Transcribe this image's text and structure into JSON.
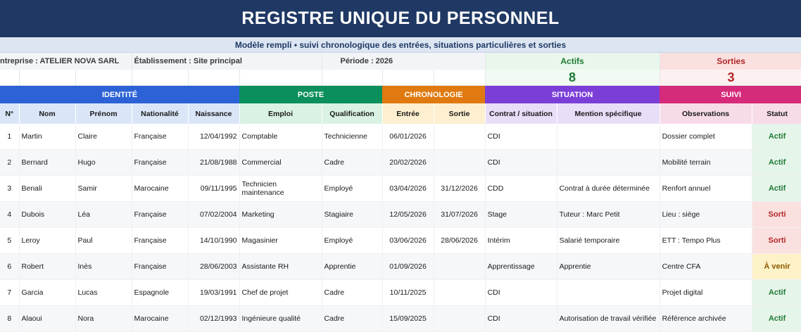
{
  "title": "REGISTRE UNIQUE DU PERSONNEL",
  "subtitle": "Modèle rempli • suivi chronologique des entrées, situations particulières et sorties",
  "info": {
    "entreprise": "ntreprise : ATELIER NOVA SARL",
    "etablissement": "Établissement : Site principal",
    "periode": "Période : 2026"
  },
  "summary": {
    "actifs_label": "Actifs",
    "actifs_value": "8",
    "sorties_label": "Sorties",
    "sorties_value": "3"
  },
  "groups": {
    "identite": "IDENTITÉ",
    "poste": "POSTE",
    "chronologie": "CHRONOLOGIE",
    "situation": "SITUATION",
    "suivi": "SUIVI"
  },
  "columns": {
    "num": "N°",
    "nom": "Nom",
    "prenom": "Prénom",
    "nationalite": "Nationalité",
    "naissance": "Naissance",
    "emploi": "Emploi",
    "qualification": "Qualification",
    "entree": "Entrée",
    "sortie": "Sortie",
    "contrat": "Contrat / situation",
    "mention": "Mention spécifique",
    "observations": "Observations",
    "statut": "Statut"
  },
  "status_colors": {
    "Actif": "#1e7b34",
    "Sorti": "#b32626",
    "À venir": "#8a5a00"
  },
  "rows": [
    {
      "n": "1",
      "nom": "Martin",
      "prenom": "Claire",
      "nat": "Française",
      "naiss": "12/04/1992",
      "emploi": "Comptable",
      "qual": "Technicienne",
      "entree": "06/01/2026",
      "sortie": "",
      "contrat": "CDI",
      "mention": "",
      "obs": "Dossier complet",
      "statut": "Actif",
      "status_type": "actif"
    },
    {
      "n": "2",
      "nom": "Bernard",
      "prenom": "Hugo",
      "nat": "Française",
      "naiss": "21/08/1988",
      "emploi": "Commercial",
      "qual": "Cadre",
      "entree": "20/02/2026",
      "sortie": "",
      "contrat": "CDI",
      "mention": "",
      "obs": "Mobilité terrain",
      "statut": "Actif",
      "status_type": "actif"
    },
    {
      "n": "3",
      "nom": "Benali",
      "prenom": "Samir",
      "nat": "Marocaine",
      "naiss": "09/11/1995",
      "emploi": "Technicien maintenance",
      "qual": "Employé",
      "entree": "03/04/2026",
      "sortie": "31/12/2026",
      "contrat": "CDD",
      "mention": "Contrat à durée déterminée",
      "obs": "Renfort annuel",
      "statut": "Actif",
      "status_type": "actif"
    },
    {
      "n": "4",
      "nom": "Dubois",
      "prenom": "Léa",
      "nat": "Française",
      "naiss": "07/02/2004",
      "emploi": "Marketing",
      "qual": "Stagiaire",
      "entree": "12/05/2026",
      "sortie": "31/07/2026",
      "contrat": "Stage",
      "mention": "Tuteur : Marc Petit",
      "obs": "Lieu : siège",
      "statut": "Sorti",
      "status_type": "sorti"
    },
    {
      "n": "5",
      "nom": "Leroy",
      "prenom": "Paul",
      "nat": "Française",
      "naiss": "14/10/1990",
      "emploi": "Magasinier",
      "qual": "Employé",
      "entree": "03/06/2026",
      "sortie": "28/06/2026",
      "contrat": "Intérim",
      "mention": "Salarié temporaire",
      "obs": "ETT : Tempo Plus",
      "statut": "Sorti",
      "status_type": "sorti"
    },
    {
      "n": "6",
      "nom": "Robert",
      "prenom": "Inès",
      "nat": "Française",
      "naiss": "28/06/2003",
      "emploi": "Assistante RH",
      "qual": "Apprentie",
      "entree": "01/09/2026",
      "sortie": "",
      "contrat": "Apprentissage",
      "mention": "Apprentie",
      "obs": "Centre CFA",
      "statut": "À venir",
      "status_type": "venir"
    },
    {
      "n": "7",
      "nom": "Garcia",
      "prenom": "Lucas",
      "nat": "Espagnole",
      "naiss": "19/03/1991",
      "emploi": "Chef de projet",
      "qual": "Cadre",
      "entree": "10/11/2025",
      "sortie": "",
      "contrat": "CDI",
      "mention": "",
      "obs": "Projet digital",
      "statut": "Actif",
      "status_type": "actif"
    },
    {
      "n": "8",
      "nom": "Alaoui",
      "prenom": "Nora",
      "nat": "Marocaine",
      "naiss": "02/12/1993",
      "emploi": "Ingénieure qualité",
      "qual": "Cadre",
      "entree": "15/09/2025",
      "sortie": "",
      "contrat": "CDI",
      "mention": "Autorisation de travail vérifiée",
      "obs": "Référence archivée",
      "statut": "Actif",
      "status_type": "actif"
    }
  ]
}
